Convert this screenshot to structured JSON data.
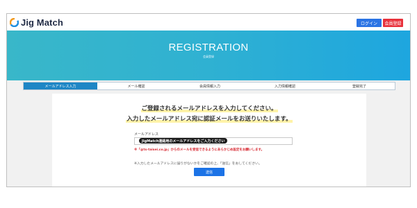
{
  "header": {
    "app_name": "Jig Match",
    "login_label": "ログイン",
    "register_label": "会員登録"
  },
  "banner": {
    "title": "REGISTRATION",
    "subtitle": "会員登録"
  },
  "steps": [
    {
      "label": "メールアドレス入力",
      "active": true
    },
    {
      "label": "メール確認",
      "active": false
    },
    {
      "label": "会員情報入力",
      "active": false
    },
    {
      "label": "入力情報確認",
      "active": false
    },
    {
      "label": "登録完了",
      "active": false
    }
  ],
  "form": {
    "lead_line1": "ご登録されるメールアドレスを入力してください。",
    "lead_line2": "入力したメールアドレス宛に認証メールをお送りいたします。",
    "email_label": "メールアドレス",
    "email_value": "",
    "email_tooltip": "JigMatch連絡用のメールアドレスをご入力ください",
    "warning": "※「@ts-taisei.co.jp」からのメールを受信できるようにあらかじめ設定をお願いします。",
    "note": "※入力したメールアドレスに誤りがないかをご確認の上、「送信」をおしてください。",
    "submit_label": "送信"
  },
  "colors": {
    "brand_navy": "#1f2a44",
    "login_blue": "#2b74e4",
    "register_red": "#e8323c",
    "step_active": "#1e86c5",
    "warning_red": "#d7262f"
  },
  "icons": {
    "logo": "jig-match-logo-icon"
  }
}
